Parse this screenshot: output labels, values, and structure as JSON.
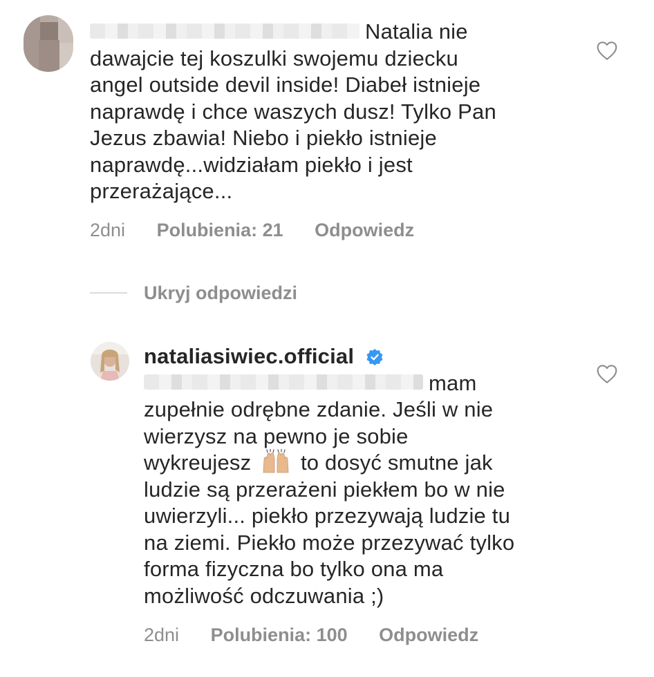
{
  "comments": [
    {
      "username": "",
      "lines": [
        "Natalia nie",
        "dawajcie tej koszulki swojemu dziecku",
        "angel outside devil inside! Diabeł istnieje",
        "naprawdę i chce waszych dusz! Tylko Pan",
        "Jezus zbawia! Niebo i piekło istnieje",
        "naprawdę...widziałam piekło i jest",
        "przerażające..."
      ],
      "time": "2dni",
      "likes": "Polubienia: 21",
      "reply": "Odpowiedz"
    },
    {
      "username": "nataliasiwiec.official",
      "lines": [
        "mam",
        "zupełnie odrębne zdanie. Jeśli w nie",
        "wierzysz na pewno  je sobie",
        "wykreujesz",
        "to dosyć smutne jak",
        "ludzie są przerażeni piekłem bo w nie",
        "uwierzyli... piekło przezywają ludzie tu",
        "na ziemi. Piekło może przezywać tylko",
        "forma fizyczna bo tylko ona ma",
        "możliwość odczuwania ;)"
      ],
      "time": "2dni",
      "likes": "Polubienia: 100",
      "reply": "Odpowiedz"
    }
  ],
  "hide_replies": "Ukryj odpowiedzi",
  "icons": {
    "heart": "heart-outline-icon",
    "verified": "verified-badge-icon",
    "emoji": "raising-hands-emoji"
  },
  "colors": {
    "text": "#262626",
    "meta": "#8e8e8e",
    "verified": "#3897f0"
  }
}
